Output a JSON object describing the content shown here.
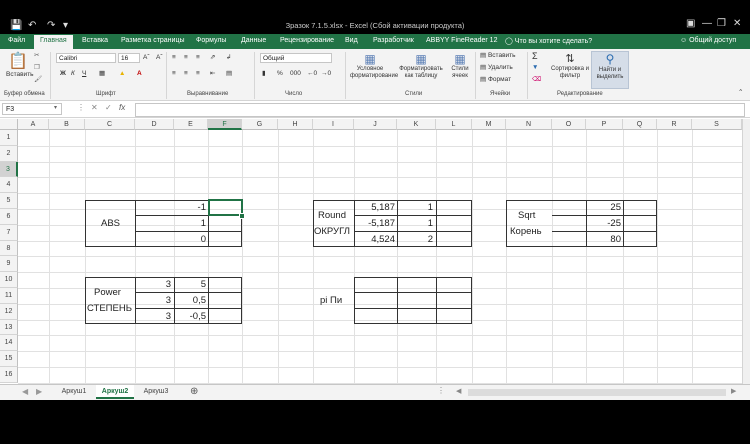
{
  "window": {
    "title": "Зразок 7.1.5.xlsx - Excel (Сбой активации продукта)"
  },
  "ribbon": {
    "tabs": [
      "Файл",
      "Главная",
      "Вставка",
      "Разметка страницы",
      "Формулы",
      "Данные",
      "Рецензирование",
      "Вид",
      "Разработчик",
      "ABBYY FineReader 12"
    ],
    "active_tab": "Главная",
    "tell_me": "Что вы хотите сделать?",
    "share": "Общий доступ",
    "paste": "Вставить",
    "font_name": "Calibri",
    "font_size": "16",
    "bold": "Ж",
    "italic": "К",
    "underline": "Ч",
    "number_format": "Общий",
    "conditional": "Условное форматирование",
    "format_table": "Форматировать как таблицу",
    "cell_styles": "Стили ячеек",
    "insert": "Вставить",
    "delete": "Удалить",
    "format": "Формат",
    "sort": "Сортировка и фильтр",
    "find": "Найти и выделить",
    "groups": {
      "clipboard": "Буфер обмена",
      "font": "Шрифт",
      "alignment": "Выравнивание",
      "number": "Число",
      "styles": "Стили",
      "cells": "Ячейки",
      "editing": "Редактирование"
    }
  },
  "formula_bar": {
    "name_box": "F3",
    "fx": "fx",
    "value": ""
  },
  "columns": [
    "A",
    "B",
    "C",
    "D",
    "E",
    "F",
    "G",
    "H",
    "I",
    "J",
    "K",
    "L",
    "M",
    "N",
    "O",
    "P",
    "Q",
    "R",
    "S"
  ],
  "rows": [
    "1",
    "2",
    "3",
    "4",
    "5",
    "6",
    "7",
    "8",
    "9",
    "10",
    "11",
    "12",
    "13",
    "14",
    "15",
    "16"
  ],
  "cells": {
    "abs_label": "ABS",
    "e3": "-1",
    "e4": "1",
    "e5": "0",
    "round_label": "Round",
    "okrugl_label": "ОКРУГЛ",
    "j3": "5,187",
    "k3": "1",
    "j4": "-5,187",
    "k4": "1",
    "j5": "4,524",
    "k5": "2",
    "sqrt_label": "Sqrt",
    "koren_label": "Корень",
    "p3": "25",
    "p4": "-25",
    "p5": "80",
    "power_label": "Power",
    "stepen_label": "СТЕПЕНЬ",
    "d8": "3",
    "e8": "5",
    "d9": "3",
    "e9": "0,5",
    "d10": "3",
    "e10": "-0,5",
    "pi_label": "pi Пи"
  },
  "sheets": {
    "tabs": [
      "Аркуш1",
      "Аркуш2",
      "Аркуш3"
    ],
    "active": "Аркуш2"
  }
}
